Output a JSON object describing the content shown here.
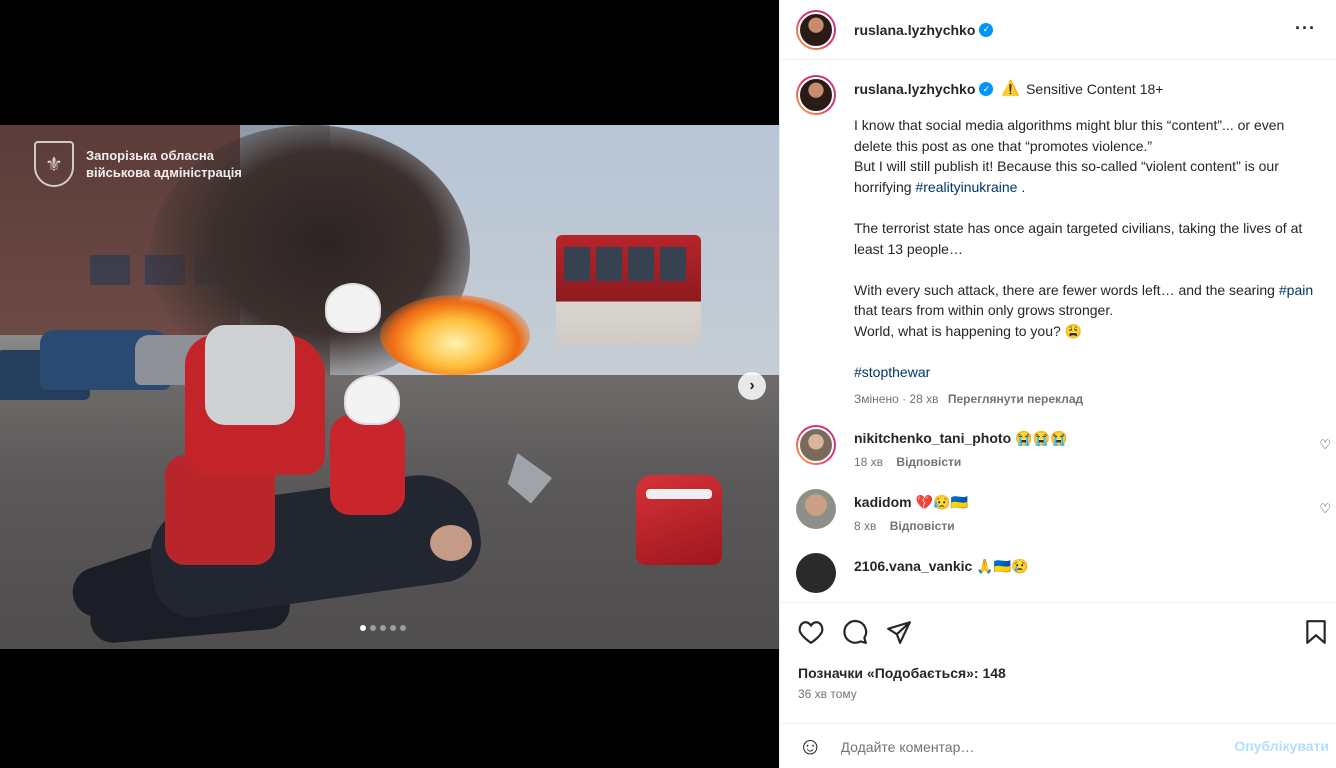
{
  "post": {
    "watermark_line1": "Запорізька обласна",
    "watermark_line2": "військова адміністрація",
    "carousel_dots": 5,
    "active_dot": 0
  },
  "header": {
    "username": "ruslana.lyzhychko",
    "more_icon": "more-horizontal-icon"
  },
  "caption": {
    "username": "ruslana.lyzhychko",
    "warning_icon": "⚠️",
    "sensitive_label": "Sensitive Content 18+",
    "p1": "I know that social media algorithms might blur this “content”... or even delete this post as one that “promotes violence.”\nBut I will still publish it! Because this so-called “violent content” is our horrifying",
    "p1_tag": "#realityinukraine",
    "p1_end": " .",
    "p2": "The terrorist state has once again targeted civilians, taking the lives of at least 13 people…",
    "p3_start": "With every such attack, there are fewer words left… and the searing ",
    "p3_tag": "#pain",
    "p3_end": " that tears from within only grows stronger.\nWorld, what is happening to you? 😩",
    "p4_tag": "#stopthewar",
    "edited": "Змінено · 28 хв",
    "translate": "Переглянути переклад"
  },
  "comments": [
    {
      "username": "nikitchenko_tani_photo",
      "text": "😭😭😭",
      "time": "18 хв",
      "reply": "Відповісти"
    },
    {
      "username": "kadidom",
      "text": "💔😥🇺🇦",
      "time": "8 хв",
      "reply": "Відповісти"
    },
    {
      "username": "2106.vana_vankic",
      "text": "🙏🇺🇦😢",
      "time": "",
      "reply": ""
    }
  ],
  "actions": {
    "likes": "Позначки «Подобається»: 148",
    "time_ago": "36 хв тому"
  },
  "add_comment": {
    "placeholder": "Додайте коментар…",
    "post_label": "Опублікувати"
  },
  "colors": {
    "link": "#00376b",
    "verified": "#0095f6",
    "post_disabled": "#b2dffc"
  }
}
